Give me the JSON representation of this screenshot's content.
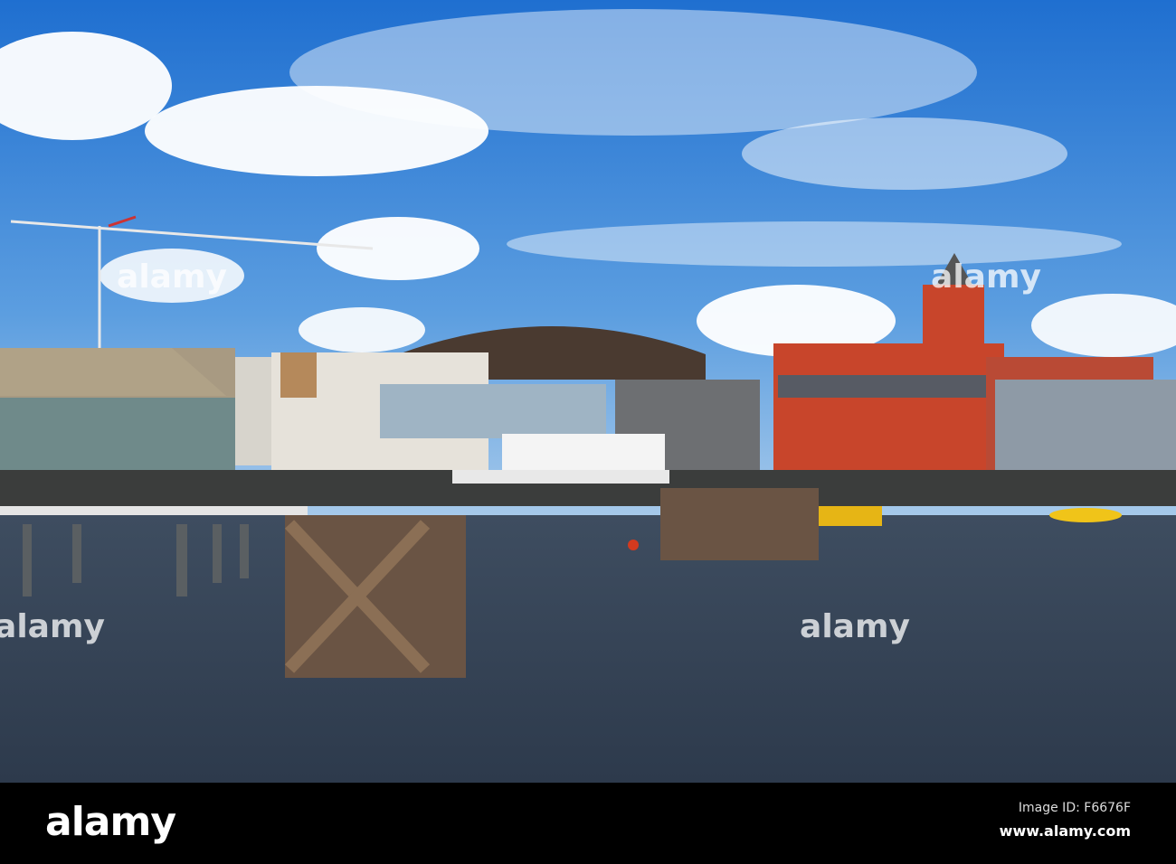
{
  "watermark": {
    "text": "alamy"
  },
  "footer": {
    "logo": "alamy",
    "image_id": "Image ID: F6676F",
    "website": "www.alamy.com"
  }
}
